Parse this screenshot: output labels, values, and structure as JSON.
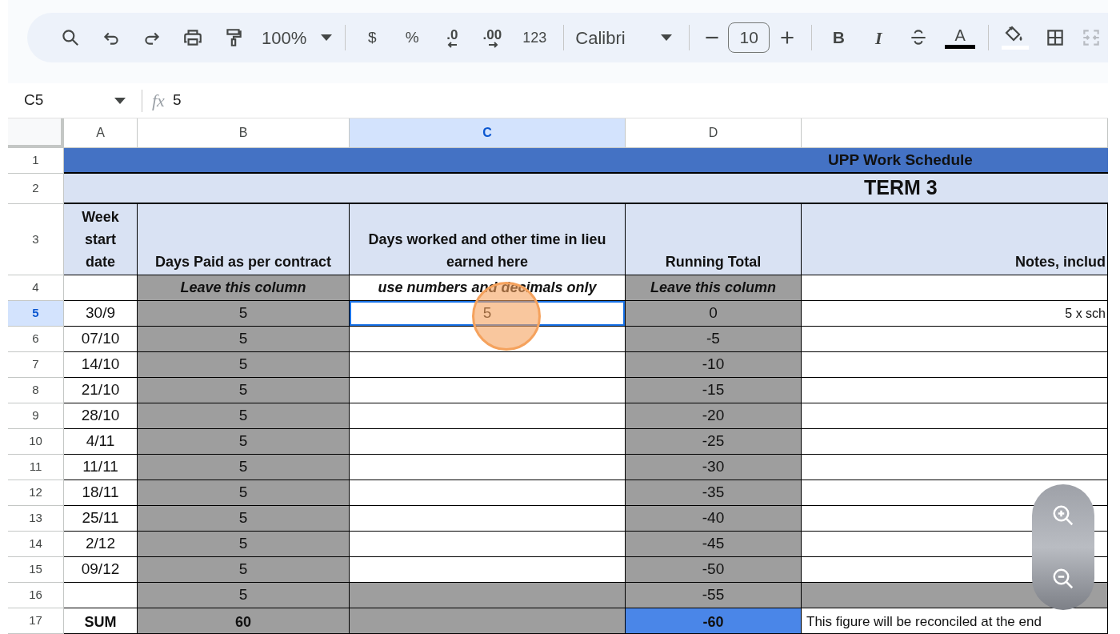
{
  "toolbar": {
    "zoom": "100%",
    "currency": "$",
    "percent": "%",
    "decrease_decimal": ".0",
    "increase_decimal": ".00",
    "number_format": "123",
    "font": "Calibri",
    "font_size": "10",
    "bold": "B",
    "italic": "I",
    "text_color": "A"
  },
  "formula_bar": {
    "cell": "C5",
    "fx": "fx",
    "value": "5"
  },
  "columns": [
    {
      "label": "A",
      "selected": false
    },
    {
      "label": "B",
      "selected": false
    },
    {
      "label": "C",
      "selected": true
    },
    {
      "label": "D",
      "selected": false
    },
    {
      "selected": false
    }
  ],
  "rows": [
    {
      "number": "1",
      "selected": false,
      "kind": "title",
      "text": "UPP Work Schedule"
    },
    {
      "number": "2",
      "selected": false,
      "kind": "subtitle",
      "text": "TERM 3"
    },
    {
      "number": "3",
      "selected": false,
      "kind": "header",
      "cells": [
        {
          "text": "Week start date",
          "color": "#d9e2f3",
          "selected": false
        },
        {
          "text": "Days Paid as per contract",
          "color": "#d9e2f3",
          "selected": false
        },
        {
          "text": "Days worked and other time in lieu earned here",
          "color": "#d9e2f3",
          "selected": false
        },
        {
          "text": "Running Total",
          "color": "#d9e2f3",
          "selected": false
        },
        {
          "text": "Notes, includ",
          "color": "#d9e2f3",
          "selected": false
        }
      ]
    },
    {
      "number": "4",
      "selected": false,
      "kind": "note",
      "cells": [
        {
          "color": "#ffffff",
          "selected": false
        },
        {
          "text": "Leave this column",
          "color": "#9e9e9e",
          "selected": false
        },
        {
          "text": "use numbers and decimals only",
          "color": "#ffffff",
          "selected": false
        },
        {
          "text": "Leave this column",
          "color": "#9e9e9e",
          "selected": false
        },
        {
          "color": "#ffffff",
          "selected": false
        }
      ]
    },
    {
      "number": "5",
      "selected": true,
      "kind": "data",
      "cells": [
        {
          "text": "30/9",
          "color": "#ffffff",
          "selected": false
        },
        {
          "text": "5",
          "color": "#9e9e9e",
          "selected": false
        },
        {
          "text": "5",
          "color": "#ffffff",
          "selected": true
        },
        {
          "text": "0",
          "color": "#9e9e9e",
          "selected": false
        },
        {
          "text": "5 x sch",
          "color": "#ffffff",
          "selected": false
        }
      ]
    },
    {
      "number": "6",
      "selected": false,
      "kind": "data",
      "cells": [
        {
          "text": "07/10",
          "color": "#ffffff",
          "selected": false
        },
        {
          "text": "5",
          "color": "#9e9e9e",
          "selected": false
        },
        {
          "color": "#ffffff",
          "selected": false
        },
        {
          "text": "-5",
          "color": "#9e9e9e",
          "selected": false
        },
        {
          "color": "#ffffff",
          "selected": false
        }
      ]
    },
    {
      "number": "7",
      "selected": false,
      "kind": "data",
      "cells": [
        {
          "text": "14/10",
          "color": "#ffffff",
          "selected": false
        },
        {
          "text": "5",
          "color": "#9e9e9e",
          "selected": false
        },
        {
          "color": "#ffffff",
          "selected": false
        },
        {
          "text": "-10",
          "color": "#9e9e9e",
          "selected": false
        },
        {
          "color": "#ffffff",
          "selected": false
        }
      ]
    },
    {
      "number": "8",
      "selected": false,
      "kind": "data",
      "cells": [
        {
          "text": "21/10",
          "color": "#ffffff",
          "selected": false
        },
        {
          "text": "5",
          "color": "#9e9e9e",
          "selected": false
        },
        {
          "color": "#ffffff",
          "selected": false
        },
        {
          "text": "-15",
          "color": "#9e9e9e",
          "selected": false
        },
        {
          "color": "#ffffff",
          "selected": false
        }
      ]
    },
    {
      "number": "9",
      "selected": false,
      "kind": "data",
      "cells": [
        {
          "text": "28/10",
          "color": "#ffffff",
          "selected": false
        },
        {
          "text": "5",
          "color": "#9e9e9e",
          "selected": false
        },
        {
          "color": "#ffffff",
          "selected": false
        },
        {
          "text": "-20",
          "color": "#9e9e9e",
          "selected": false
        },
        {
          "color": "#ffffff",
          "selected": false
        }
      ]
    },
    {
      "number": "10",
      "selected": false,
      "kind": "data",
      "cells": [
        {
          "text": "4/11",
          "color": "#ffffff",
          "selected": false
        },
        {
          "text": "5",
          "color": "#9e9e9e",
          "selected": false
        },
        {
          "color": "#ffffff",
          "selected": false
        },
        {
          "text": "-25",
          "color": "#9e9e9e",
          "selected": false
        },
        {
          "color": "#ffffff",
          "selected": false
        }
      ]
    },
    {
      "number": "11",
      "selected": false,
      "kind": "data",
      "cells": [
        {
          "text": "11/11",
          "color": "#ffffff",
          "selected": false
        },
        {
          "text": "5",
          "color": "#9e9e9e",
          "selected": false
        },
        {
          "color": "#ffffff",
          "selected": false
        },
        {
          "text": "-30",
          "color": "#9e9e9e",
          "selected": false
        },
        {
          "color": "#ffffff",
          "selected": false
        }
      ]
    },
    {
      "number": "12",
      "selected": false,
      "kind": "data",
      "cells": [
        {
          "text": "18/11",
          "color": "#ffffff",
          "selected": false
        },
        {
          "text": "5",
          "color": "#9e9e9e",
          "selected": false
        },
        {
          "color": "#ffffff",
          "selected": false
        },
        {
          "text": "-35",
          "color": "#9e9e9e",
          "selected": false
        },
        {
          "color": "#ffffff",
          "selected": false
        }
      ]
    },
    {
      "number": "13",
      "selected": false,
      "kind": "data",
      "cells": [
        {
          "text": "25/11",
          "color": "#ffffff",
          "selected": false
        },
        {
          "text": "5",
          "color": "#9e9e9e",
          "selected": false
        },
        {
          "color": "#ffffff",
          "selected": false
        },
        {
          "text": "-40",
          "color": "#9e9e9e",
          "selected": false
        },
        {
          "color": "#ffffff",
          "selected": false
        }
      ]
    },
    {
      "number": "14",
      "selected": false,
      "kind": "data",
      "cells": [
        {
          "text": "2/12",
          "color": "#ffffff",
          "selected": false
        },
        {
          "text": "5",
          "color": "#9e9e9e",
          "selected": false
        },
        {
          "color": "#ffffff",
          "selected": false
        },
        {
          "text": "-45",
          "color": "#9e9e9e",
          "selected": false
        },
        {
          "color": "#ffffff",
          "selected": false
        }
      ]
    },
    {
      "number": "15",
      "selected": false,
      "kind": "data",
      "cells": [
        {
          "text": "09/12",
          "color": "#ffffff",
          "selected": false
        },
        {
          "text": "5",
          "color": "#9e9e9e",
          "selected": false
        },
        {
          "color": "#ffffff",
          "selected": false
        },
        {
          "text": "-50",
          "color": "#9e9e9e",
          "selected": false
        },
        {
          "color": "#ffffff",
          "selected": false
        }
      ]
    },
    {
      "number": "16",
      "selected": false,
      "kind": "data",
      "cells": [
        {
          "color": "#ffffff",
          "selected": false
        },
        {
          "text": "5",
          "color": "#9e9e9e",
          "selected": false
        },
        {
          "color": "#9e9e9e",
          "selected": false
        },
        {
          "text": "-55",
          "color": "#9e9e9e",
          "selected": false
        },
        {
          "color": "#9e9e9e",
          "selected": false
        }
      ]
    },
    {
      "number": "17",
      "selected": false,
      "kind": "total",
      "cells": [
        {
          "text": "SUM",
          "color": "#ffffff",
          "selected": false
        },
        {
          "text": "60",
          "color": "#9e9e9e",
          "selected": false
        },
        {
          "color": "#9e9e9e",
          "selected": false
        },
        {
          "text": "-60",
          "color": "#4a86e8",
          "selected": false
        },
        {
          "text": "This figure will be reconciled at the end",
          "color": "#ffffff",
          "selected": false
        }
      ]
    }
  ]
}
